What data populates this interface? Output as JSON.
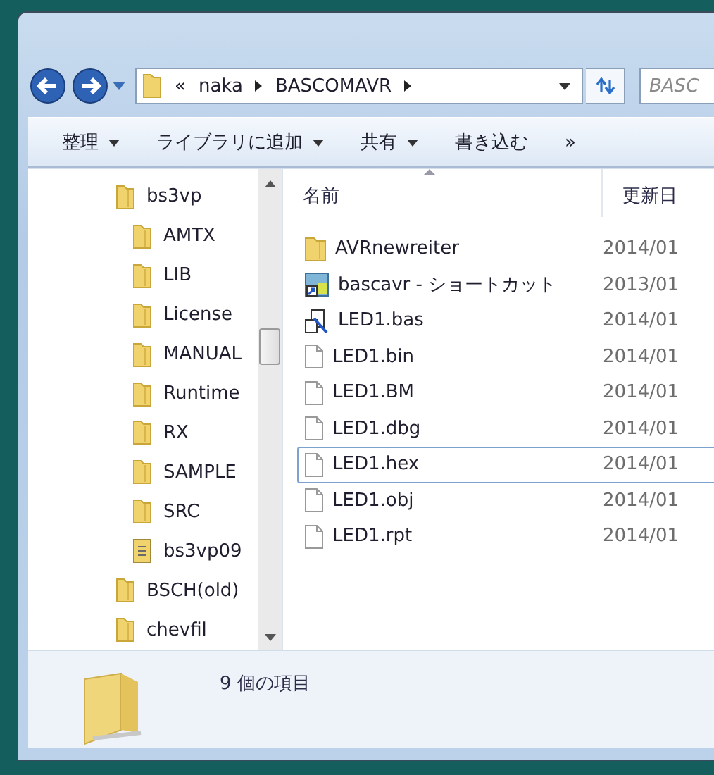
{
  "address_bar": {
    "overflow": "«",
    "path": [
      {
        "label": "naka"
      },
      {
        "label": "BASCOMAVR"
      }
    ]
  },
  "search": {
    "placeholder": "BASC"
  },
  "toolbar": {
    "items": [
      {
        "label": "整理",
        "dropdown": true
      },
      {
        "label": "ライブラリに追加",
        "dropdown": true
      },
      {
        "label": "共有",
        "dropdown": true
      },
      {
        "label": "書き込む",
        "dropdown": false
      },
      {
        "label": "»",
        "dropdown": false
      }
    ]
  },
  "nav_tree": [
    {
      "label": "bs3vp",
      "kind": "folder",
      "children": [
        {
          "label": "AMTX",
          "kind": "folder"
        },
        {
          "label": "LIB",
          "kind": "folder"
        },
        {
          "label": "License",
          "kind": "folder"
        },
        {
          "label": "MANUAL",
          "kind": "folder"
        },
        {
          "label": "Runtime",
          "kind": "folder"
        },
        {
          "label": "RX",
          "kind": "folder"
        },
        {
          "label": "SAMPLE",
          "kind": "folder"
        },
        {
          "label": "SRC",
          "kind": "folder"
        },
        {
          "label": "bs3vp09",
          "kind": "archive"
        }
      ]
    },
    {
      "label": "BSCH(old)",
      "kind": "folder"
    },
    {
      "label": "chevfil",
      "kind": "folder"
    }
  ],
  "file_list": {
    "columns": [
      "名前",
      "更新日"
    ],
    "rows": [
      {
        "name": "AVRnewreiter",
        "kind": "folder",
        "date": "2014/01",
        "selected": false
      },
      {
        "name": "bascavr - ショートカット",
        "kind": "shortcut",
        "date": "2013/01",
        "selected": false
      },
      {
        "name": "LED1.bas",
        "kind": "source",
        "date": "2014/01",
        "selected": false
      },
      {
        "name": "LED1.bin",
        "kind": "file",
        "date": "2014/01",
        "selected": false
      },
      {
        "name": "LED1.BM",
        "kind": "file",
        "date": "2014/01",
        "selected": false
      },
      {
        "name": "LED1.dbg",
        "kind": "file",
        "date": "2014/01",
        "selected": false
      },
      {
        "name": "LED1.hex",
        "kind": "file",
        "date": "2014/01",
        "selected": true
      },
      {
        "name": "LED1.obj",
        "kind": "file",
        "date": "2014/01",
        "selected": false
      },
      {
        "name": "LED1.rpt",
        "kind": "file",
        "date": "2014/01",
        "selected": false
      }
    ]
  },
  "status": {
    "item_count": "9 個の項目"
  }
}
